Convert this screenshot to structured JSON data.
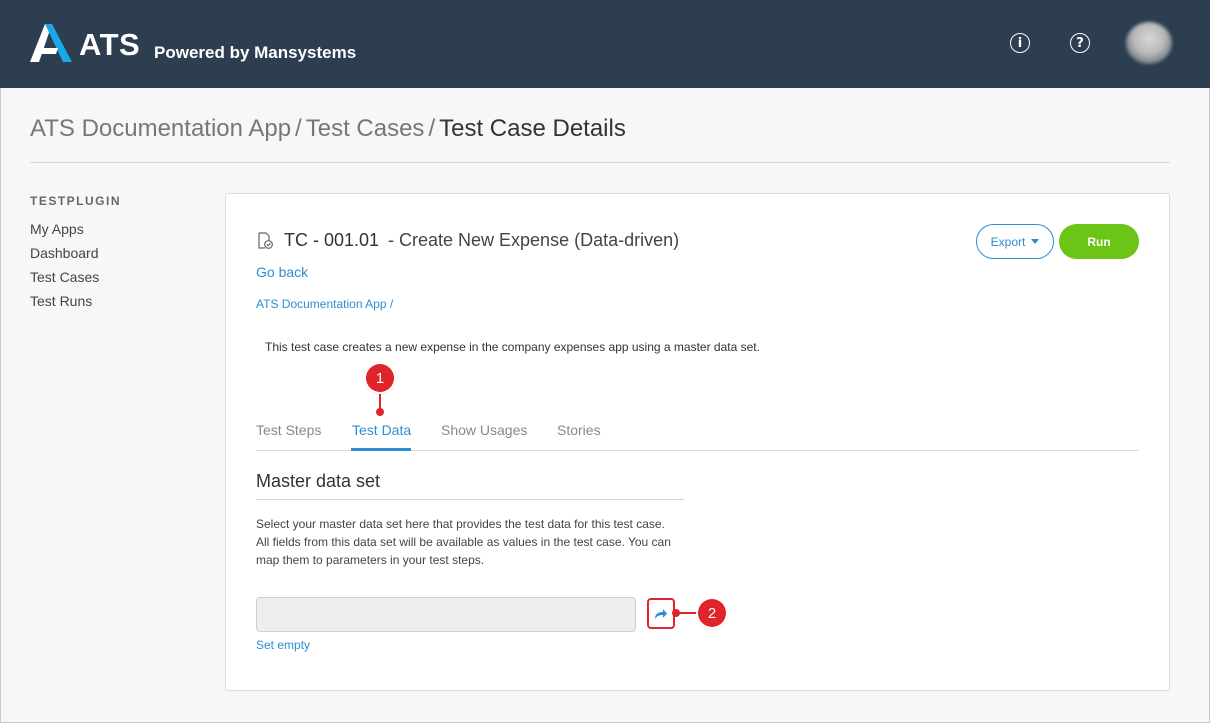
{
  "header": {
    "brand": "ATS",
    "tagline": "Powered by Mansystems",
    "info_icon": "info-icon",
    "help_icon": "help-icon"
  },
  "breadcrumb": {
    "items": [
      "ATS Documentation App",
      "Test Cases"
    ],
    "current": "Test Case Details",
    "separator": "/"
  },
  "sidebar": {
    "heading": "TESTPLUGIN",
    "items": [
      {
        "label": "My Apps"
      },
      {
        "label": "Dashboard"
      },
      {
        "label": "Test Cases"
      },
      {
        "label": "Test Runs"
      }
    ]
  },
  "test_case": {
    "id": "TC - 001.01",
    "title": "- Create New Expense (Data-driven)",
    "go_back": "Go back",
    "app_link": "ATS Documentation App",
    "app_link_sep": "/",
    "description": "This test case creates a new expense in the company expenses app using a master data set.",
    "export_label": "Export",
    "run_label": "Run"
  },
  "tabs": [
    {
      "label": "Test Steps",
      "active": false
    },
    {
      "label": "Test Data",
      "active": true
    },
    {
      "label": "Show Usages",
      "active": false
    },
    {
      "label": "Stories",
      "active": false
    }
  ],
  "master_data": {
    "title": "Master data set",
    "help_line1": "Select your master data set here that provides the test data for this test case.",
    "help_line2": "All fields from this data set will be available as values in the test case. You can map them to parameters in your test steps.",
    "input_value": "",
    "set_empty": "Set empty"
  },
  "callouts": [
    "1",
    "2"
  ],
  "colors": {
    "header_bg": "#2c3e50",
    "accent": "#2c8dd1",
    "run": "#6cc417",
    "callout": "#e0242b"
  }
}
